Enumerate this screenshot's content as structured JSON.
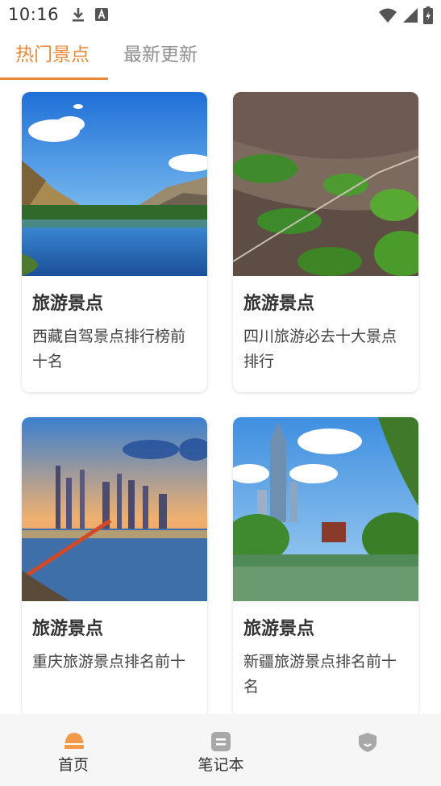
{
  "status_bar": {
    "time": "10:16",
    "left_icons": [
      "download-icon",
      "a-box-icon"
    ],
    "right_icons": [
      "wifi-icon",
      "signal-icon",
      "battery-icon"
    ]
  },
  "tabs": [
    {
      "label": "热门景点",
      "active": true
    },
    {
      "label": "最新更新",
      "active": false
    }
  ],
  "colors": {
    "accent": "#e8893a",
    "inactive_tab": "#8f8f8f",
    "nav_active": "#f39a4a",
    "nav_inactive": "#a8a8a8"
  },
  "cards": [
    {
      "title": "旅游景点",
      "desc": "西藏自驾景点排行榜前十名",
      "image": "lake-mountains-image"
    },
    {
      "title": "旅游景点",
      "desc": "四川旅游必去十大景点排行",
      "image": "mountain-trail-image"
    },
    {
      "title": "旅游景点",
      "desc": "重庆旅游景点排名前十",
      "image": "city-river-night-image"
    },
    {
      "title": "旅游景点",
      "desc": "新疆旅游景点排名前十名",
      "image": "park-tower-image"
    }
  ],
  "bottom_nav": [
    {
      "label": "首页",
      "icon": "home-icon",
      "active": true
    },
    {
      "label": "笔记本",
      "icon": "notebook-icon",
      "active": false
    },
    {
      "label": "",
      "icon": "profile-icon",
      "active": false
    }
  ]
}
